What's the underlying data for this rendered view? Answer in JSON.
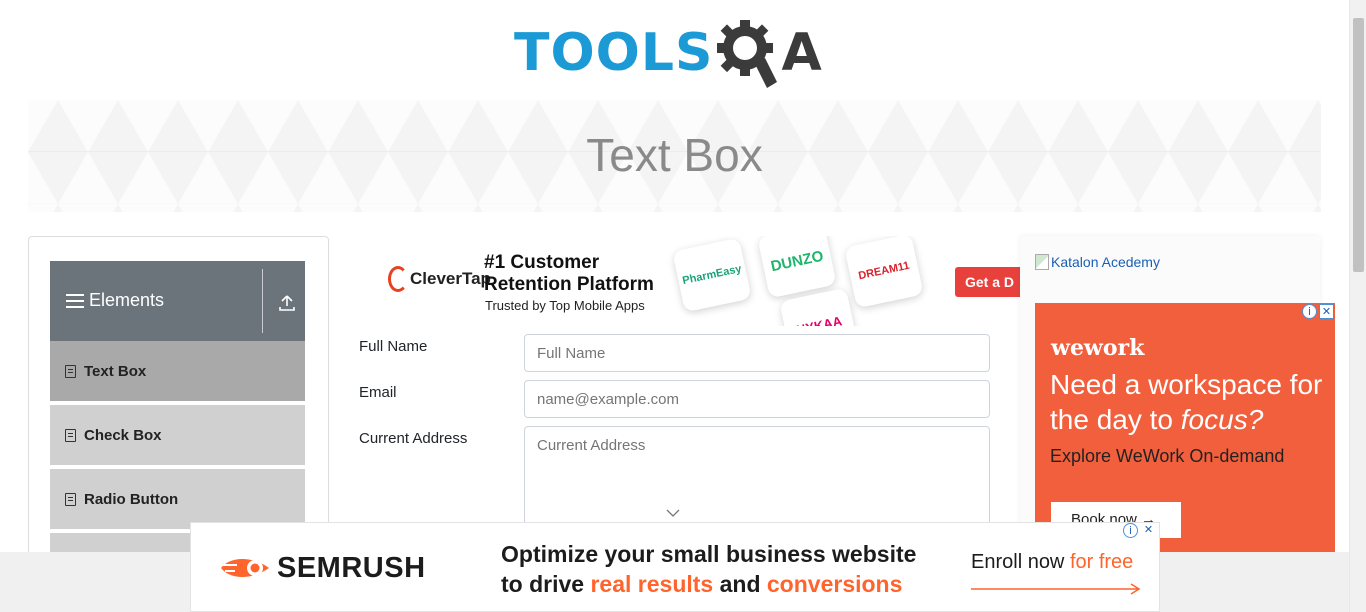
{
  "header": {
    "logo_text": "TOOLS",
    "logo_suffix": "A"
  },
  "banner": {
    "title": "Text Box"
  },
  "sidebar": {
    "group_title": "Elements",
    "items": [
      {
        "label": "Text Box",
        "active": true
      },
      {
        "label": "Check Box",
        "active": false
      },
      {
        "label": "Radio Button",
        "active": false
      }
    ]
  },
  "top_ad": {
    "brand": "CleverTap",
    "headline_line1": "#1 Customer",
    "headline_line2": "Retention Platform",
    "subline": "Trusted by Top Mobile Apps",
    "tiles": [
      "PharmEasy",
      "DUNZO",
      "DREAM11",
      "NYKAA"
    ],
    "cta": "Get a D"
  },
  "form": {
    "full_name_label": "Full Name",
    "full_name_placeholder": "Full Name",
    "email_label": "Email",
    "email_placeholder": "name@example.com",
    "address_label": "Current Address",
    "address_placeholder": "Current Address"
  },
  "right_ad": {
    "image_alt": "Katalon Acedemy",
    "brand": "wework",
    "headline_part1": "Need a workspace for the day to ",
    "headline_em": "focus?",
    "sub": "Explore WeWork On-demand",
    "cta": "Book now"
  },
  "bottom_ad": {
    "brand": "SEMRUSH",
    "line1": "Optimize your small business website",
    "line2_a": "to drive ",
    "line2_hl1": "real results",
    "line2_b": " and ",
    "line2_hl2": "conversions",
    "cta_a": "Enroll now ",
    "cta_hl": "for free"
  },
  "colors": {
    "accent": "#1b9ad6",
    "nav_header": "#6b737b",
    "wework": "#f25f3d",
    "semrush": "#ff642d",
    "clevertap_cta": "#e8413c"
  }
}
